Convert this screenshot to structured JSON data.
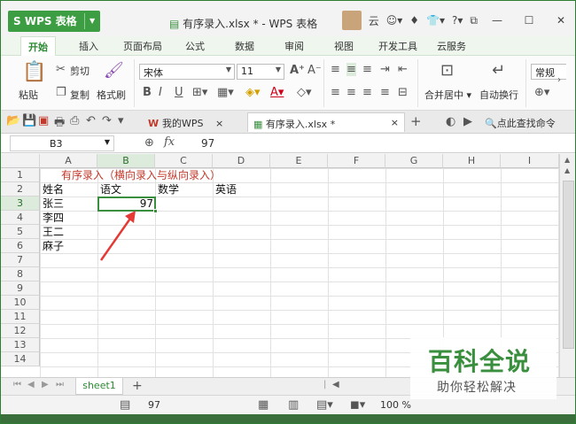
{
  "app": {
    "name": "WPS 表格",
    "window_title": "有序录入.xlsx * - WPS 表格",
    "user": "云"
  },
  "tabs": [
    "开始",
    "插入",
    "页面布局",
    "公式",
    "数据",
    "审阅",
    "视图",
    "开发工具",
    "云服务"
  ],
  "ribbon": {
    "paste": "粘贴",
    "cut": "剪切",
    "copy": "复制",
    "format_painter": "格式刷",
    "font_name": "宋体",
    "font_size": "11",
    "merge_center": "合并居中",
    "wrap_text": "自动换行",
    "number_format": "常规"
  },
  "doc_tabs": {
    "home": "我的WPS",
    "file": "有序录入.xlsx *",
    "search": "点此查找命令"
  },
  "formula_bar": {
    "cell_ref": "B3",
    "fx": "fx",
    "value": "97"
  },
  "columns": [
    "A",
    "B",
    "C",
    "D",
    "E",
    "F",
    "G",
    "H",
    "I"
  ],
  "rows": [
    "1",
    "2",
    "3",
    "4",
    "5",
    "6",
    "7",
    "8",
    "9",
    "10",
    "11",
    "12",
    "13",
    "14"
  ],
  "cells": {
    "a1": "有序录入（横向录入与纵向录入）",
    "a2": "姓名",
    "b2": "语文",
    "c2": "数学",
    "d2": "英语",
    "a3": "张三",
    "b3": "97",
    "a4": "李四",
    "a5": "王二",
    "a6": "麻子"
  },
  "sheet": {
    "name": "sheet1",
    "add": "+"
  },
  "status": {
    "value": "97",
    "zoom": "100 %"
  },
  "watermark": {
    "title": "百科全说",
    "subtitle": "助你轻松解决"
  },
  "colors": {
    "accent": "#3a8f3e",
    "title_red": "#c0392b"
  }
}
